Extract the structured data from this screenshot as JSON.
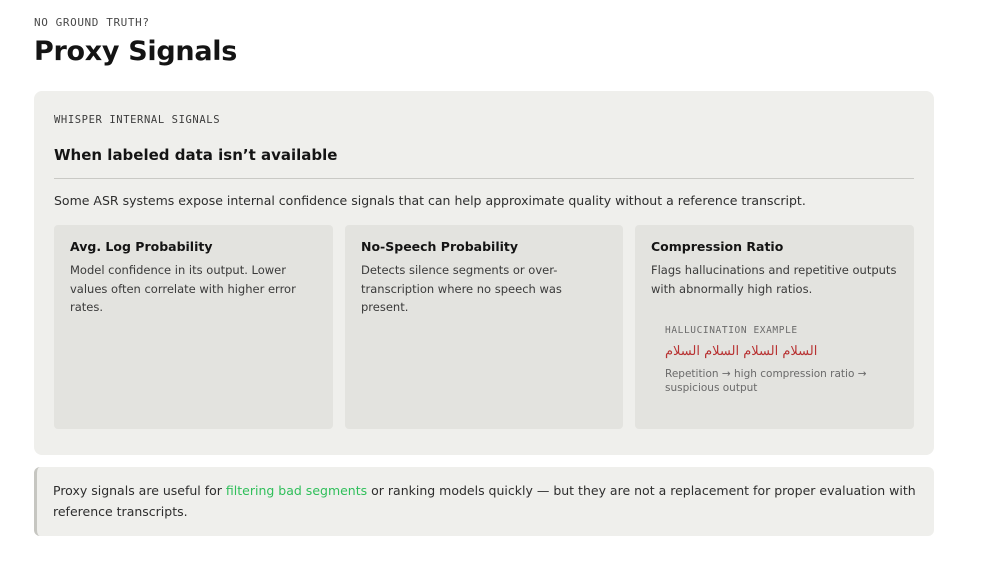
{
  "header": {
    "eyebrow": "NO GROUND TRUTH?",
    "title": "Proxy Signals"
  },
  "panel": {
    "eyebrow": "WHISPER INTERNAL SIGNALS",
    "heading": "When labeled data isn’t available",
    "intro": "Some ASR systems expose internal confidence signals that can help approximate quality without a reference transcript.",
    "cards": [
      {
        "title": "Avg. Log Probability",
        "text": "Model confidence in its output. Lower values often correlate with higher error rates."
      },
      {
        "title": "No-Speech Probability",
        "text": "Detects silence segments or over-transcription where no speech was present."
      },
      {
        "title": "Compression Ratio",
        "text": "Flags hallucinations and repetitive outputs with abnormally high ratios.",
        "example": {
          "label": "HALLUCINATION EXAMPLE",
          "text": "السلام السلام السلام السلام",
          "note": "Repetition → high compression ratio → suspicious output"
        }
      }
    ]
  },
  "callout": {
    "before": "Proxy signals are useful for ",
    "highlight": "filtering bad segments",
    "after": " or ranking models quickly — but they are not a replacement for proper evaluation with reference transcripts."
  },
  "colors": {
    "highlight": "#2fbf5a",
    "example_text": "#b83232",
    "panel_bg": "#efefec",
    "card_bg": "#e3e3df"
  }
}
